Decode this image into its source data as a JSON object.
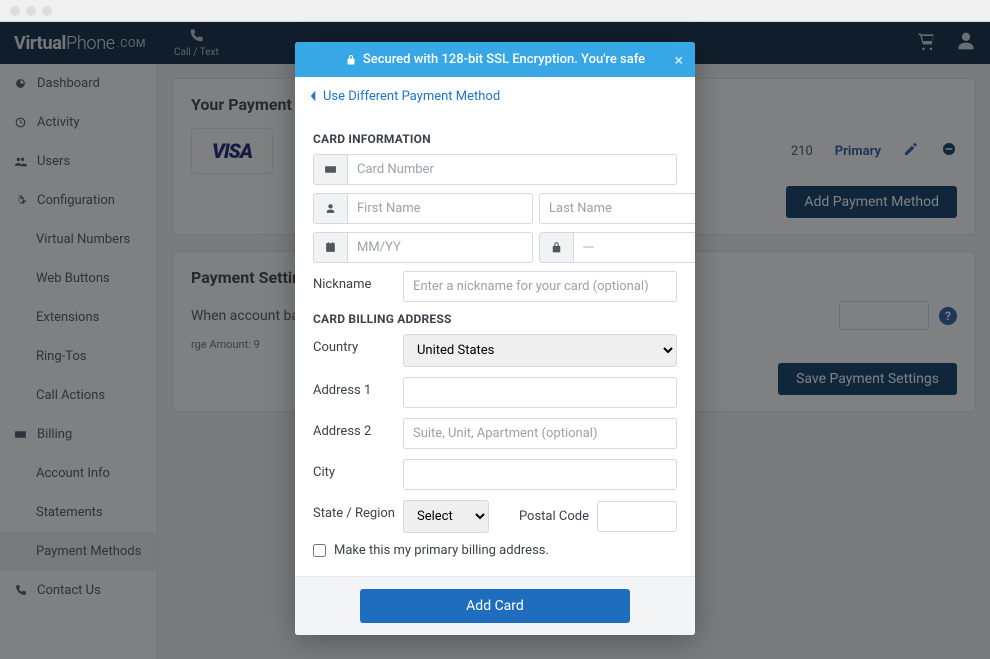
{
  "topbar": {
    "brand_virtual": "Virtual",
    "brand_phone": "Phone",
    "brand_com": ".COM",
    "call_text_label": "Call / Text"
  },
  "sidebar": {
    "dashboard": "Dashboard",
    "activity": "Activity",
    "users": "Users",
    "configuration": "Configuration",
    "virtual_numbers": "Virtual Numbers",
    "web_buttons": "Web Buttons",
    "extensions": "Extensions",
    "ring_tos": "Ring-Tos",
    "call_actions": "Call Actions",
    "billing": "Billing",
    "account_info": "Account Info",
    "statements": "Statements",
    "payment_methods": "Payment Methods",
    "contact_us": "Contact Us"
  },
  "main": {
    "pm_title_prefix": "Your Payment Me",
    "visa": "VISA",
    "masked_suffix": "210",
    "primary_label": "Primary",
    "add_pm_btn": "Add Payment Method",
    "settings_title": "Payment Settings",
    "settings_text": "When account balance",
    "recharge_note": "rge Amount: 9",
    "save_settings_btn": "Save Payment Settings"
  },
  "modal": {
    "secure_banner": "Secured with 128-bit SSL Encryption. You're safe",
    "back_link": "Use Different Payment Method",
    "card_info_title": "CARD INFORMATION",
    "card_number_ph": "Card Number",
    "first_name_ph": "First Name",
    "last_name_ph": "Last Name",
    "expiry_ph": "MM/YY",
    "cvv_ph": "---",
    "nickname_label": "Nickname",
    "nickname_ph": "Enter a nickname for your card (optional)",
    "billing_title": "CARD BILLING ADDRESS",
    "country_label": "Country",
    "country_value": "United States",
    "address1_label": "Address 1",
    "address2_label": "Address 2",
    "address2_ph": "Suite, Unit, Apartment (optional)",
    "city_label": "City",
    "state_label": "State / Region",
    "state_value": "Select",
    "postal_label": "Postal Code",
    "primary_checkbox": "Make this my primary billing address.",
    "add_card_btn": "Add Card"
  }
}
